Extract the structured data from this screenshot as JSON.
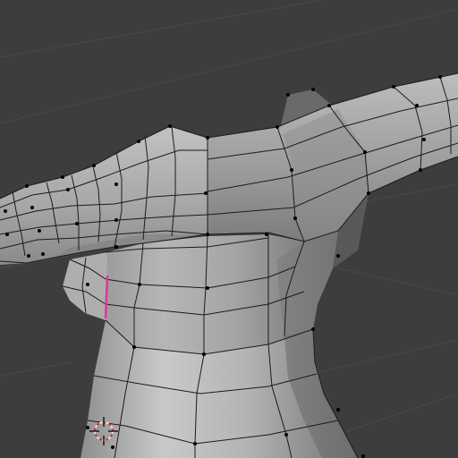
{
  "viewport": {
    "mode": "edit-mode",
    "background_color": "#3d3d3d",
    "grid_line_color": "#4a4a4a",
    "mesh_face_color": "#b4b4b4",
    "mesh_edge_color": "#1b1b1b",
    "vertex_color": "#000000",
    "selected_edge_color": "#e0369a",
    "cursor_color_a": "#e0e0e0",
    "cursor_color_b": "#d12d2d"
  },
  "scene": {
    "object": "mesh-torso-with-arms",
    "selected_edge_count": 1,
    "cursor_icon": "3d-cursor-icon"
  }
}
